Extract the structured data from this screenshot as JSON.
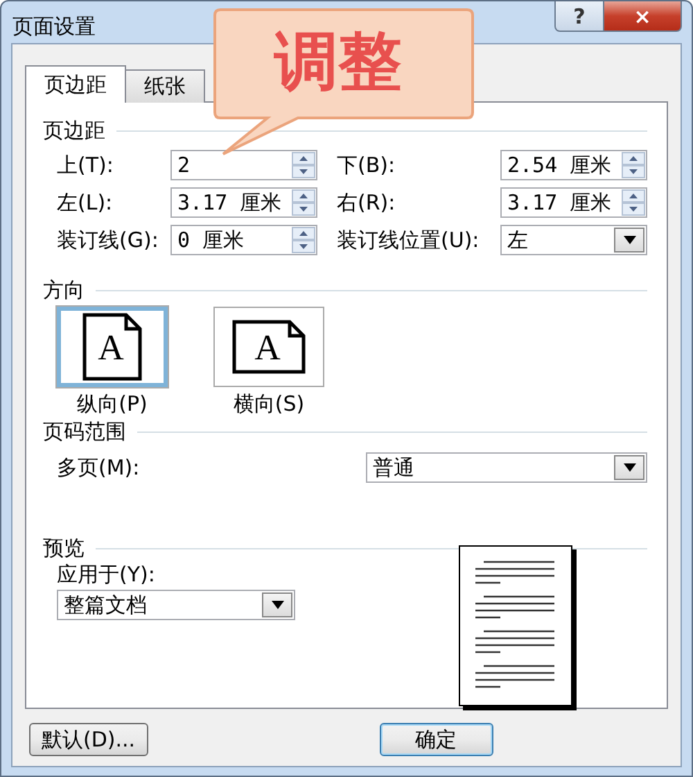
{
  "window": {
    "title": "页面设置",
    "help": "?",
    "close": "×"
  },
  "callout": {
    "text": "调整"
  },
  "tabs": [
    {
      "label": "页边距",
      "selected": true
    },
    {
      "label": "纸张",
      "selected": false
    }
  ],
  "margins": {
    "heading": "页边距",
    "rows": [
      [
        {
          "kind": "spin",
          "label": "上(T):",
          "value": "2"
        },
        {
          "kind": "spin",
          "label": "下(B):",
          "value": "2.54 厘米"
        }
      ],
      [
        {
          "kind": "spin",
          "label": "左(L):",
          "value": "3.17 厘米"
        },
        {
          "kind": "spin",
          "label": "右(R):",
          "value": "3.17 厘米"
        }
      ],
      [
        {
          "kind": "spin",
          "label": "装订线(G):",
          "value": "0 厘米"
        },
        {
          "kind": "combo",
          "label": "装订线位置(U):",
          "value": "左"
        }
      ]
    ]
  },
  "orientation": {
    "heading": "方向",
    "options": [
      {
        "label": "纵向(P)",
        "icon_letter": "A",
        "kind": "portrait",
        "selected": true
      },
      {
        "label": "横向(S)",
        "icon_letter": "A",
        "kind": "landscape",
        "selected": false
      }
    ]
  },
  "pages": {
    "heading": "页码范围",
    "label": "多页(M):",
    "value": "普通"
  },
  "preview": {
    "heading": "预览",
    "label": "应用于(Y):",
    "value": "整篇文档"
  },
  "buttons": [
    {
      "label": "默认(D)...",
      "kind": "default"
    },
    {
      "label": "确定",
      "kind": "ok"
    }
  ]
}
